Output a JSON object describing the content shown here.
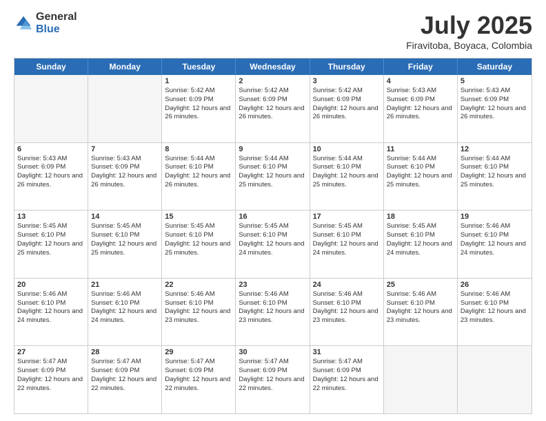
{
  "logo": {
    "general": "General",
    "blue": "Blue"
  },
  "header": {
    "month_year": "July 2025",
    "location": "Firavitoba, Boyaca, Colombia"
  },
  "weekdays": [
    "Sunday",
    "Monday",
    "Tuesday",
    "Wednesday",
    "Thursday",
    "Friday",
    "Saturday"
  ],
  "weeks": [
    [
      {
        "day": "",
        "sunrise": "",
        "sunset": "",
        "daylight": ""
      },
      {
        "day": "",
        "sunrise": "",
        "sunset": "",
        "daylight": ""
      },
      {
        "day": "1",
        "sunrise": "Sunrise: 5:42 AM",
        "sunset": "Sunset: 6:09 PM",
        "daylight": "Daylight: 12 hours and 26 minutes."
      },
      {
        "day": "2",
        "sunrise": "Sunrise: 5:42 AM",
        "sunset": "Sunset: 6:09 PM",
        "daylight": "Daylight: 12 hours and 26 minutes."
      },
      {
        "day": "3",
        "sunrise": "Sunrise: 5:42 AM",
        "sunset": "Sunset: 6:09 PM",
        "daylight": "Daylight: 12 hours and 26 minutes."
      },
      {
        "day": "4",
        "sunrise": "Sunrise: 5:43 AM",
        "sunset": "Sunset: 6:09 PM",
        "daylight": "Daylight: 12 hours and 26 minutes."
      },
      {
        "day": "5",
        "sunrise": "Sunrise: 5:43 AM",
        "sunset": "Sunset: 6:09 PM",
        "daylight": "Daylight: 12 hours and 26 minutes."
      }
    ],
    [
      {
        "day": "6",
        "sunrise": "Sunrise: 5:43 AM",
        "sunset": "Sunset: 6:09 PM",
        "daylight": "Daylight: 12 hours and 26 minutes."
      },
      {
        "day": "7",
        "sunrise": "Sunrise: 5:43 AM",
        "sunset": "Sunset: 6:09 PM",
        "daylight": "Daylight: 12 hours and 26 minutes."
      },
      {
        "day": "8",
        "sunrise": "Sunrise: 5:44 AM",
        "sunset": "Sunset: 6:10 PM",
        "daylight": "Daylight: 12 hours and 26 minutes."
      },
      {
        "day": "9",
        "sunrise": "Sunrise: 5:44 AM",
        "sunset": "Sunset: 6:10 PM",
        "daylight": "Daylight: 12 hours and 25 minutes."
      },
      {
        "day": "10",
        "sunrise": "Sunrise: 5:44 AM",
        "sunset": "Sunset: 6:10 PM",
        "daylight": "Daylight: 12 hours and 25 minutes."
      },
      {
        "day": "11",
        "sunrise": "Sunrise: 5:44 AM",
        "sunset": "Sunset: 6:10 PM",
        "daylight": "Daylight: 12 hours and 25 minutes."
      },
      {
        "day": "12",
        "sunrise": "Sunrise: 5:44 AM",
        "sunset": "Sunset: 6:10 PM",
        "daylight": "Daylight: 12 hours and 25 minutes."
      }
    ],
    [
      {
        "day": "13",
        "sunrise": "Sunrise: 5:45 AM",
        "sunset": "Sunset: 6:10 PM",
        "daylight": "Daylight: 12 hours and 25 minutes."
      },
      {
        "day": "14",
        "sunrise": "Sunrise: 5:45 AM",
        "sunset": "Sunset: 6:10 PM",
        "daylight": "Daylight: 12 hours and 25 minutes."
      },
      {
        "day": "15",
        "sunrise": "Sunrise: 5:45 AM",
        "sunset": "Sunset: 6:10 PM",
        "daylight": "Daylight: 12 hours and 25 minutes."
      },
      {
        "day": "16",
        "sunrise": "Sunrise: 5:45 AM",
        "sunset": "Sunset: 6:10 PM",
        "daylight": "Daylight: 12 hours and 24 minutes."
      },
      {
        "day": "17",
        "sunrise": "Sunrise: 5:45 AM",
        "sunset": "Sunset: 6:10 PM",
        "daylight": "Daylight: 12 hours and 24 minutes."
      },
      {
        "day": "18",
        "sunrise": "Sunrise: 5:45 AM",
        "sunset": "Sunset: 6:10 PM",
        "daylight": "Daylight: 12 hours and 24 minutes."
      },
      {
        "day": "19",
        "sunrise": "Sunrise: 5:46 AM",
        "sunset": "Sunset: 6:10 PM",
        "daylight": "Daylight: 12 hours and 24 minutes."
      }
    ],
    [
      {
        "day": "20",
        "sunrise": "Sunrise: 5:46 AM",
        "sunset": "Sunset: 6:10 PM",
        "daylight": "Daylight: 12 hours and 24 minutes."
      },
      {
        "day": "21",
        "sunrise": "Sunrise: 5:46 AM",
        "sunset": "Sunset: 6:10 PM",
        "daylight": "Daylight: 12 hours and 24 minutes."
      },
      {
        "day": "22",
        "sunrise": "Sunrise: 5:46 AM",
        "sunset": "Sunset: 6:10 PM",
        "daylight": "Daylight: 12 hours and 23 minutes."
      },
      {
        "day": "23",
        "sunrise": "Sunrise: 5:46 AM",
        "sunset": "Sunset: 6:10 PM",
        "daylight": "Daylight: 12 hours and 23 minutes."
      },
      {
        "day": "24",
        "sunrise": "Sunrise: 5:46 AM",
        "sunset": "Sunset: 6:10 PM",
        "daylight": "Daylight: 12 hours and 23 minutes."
      },
      {
        "day": "25",
        "sunrise": "Sunrise: 5:46 AM",
        "sunset": "Sunset: 6:10 PM",
        "daylight": "Daylight: 12 hours and 23 minutes."
      },
      {
        "day": "26",
        "sunrise": "Sunrise: 5:46 AM",
        "sunset": "Sunset: 6:10 PM",
        "daylight": "Daylight: 12 hours and 23 minutes."
      }
    ],
    [
      {
        "day": "27",
        "sunrise": "Sunrise: 5:47 AM",
        "sunset": "Sunset: 6:09 PM",
        "daylight": "Daylight: 12 hours and 22 minutes."
      },
      {
        "day": "28",
        "sunrise": "Sunrise: 5:47 AM",
        "sunset": "Sunset: 6:09 PM",
        "daylight": "Daylight: 12 hours and 22 minutes."
      },
      {
        "day": "29",
        "sunrise": "Sunrise: 5:47 AM",
        "sunset": "Sunset: 6:09 PM",
        "daylight": "Daylight: 12 hours and 22 minutes."
      },
      {
        "day": "30",
        "sunrise": "Sunrise: 5:47 AM",
        "sunset": "Sunset: 6:09 PM",
        "daylight": "Daylight: 12 hours and 22 minutes."
      },
      {
        "day": "31",
        "sunrise": "Sunrise: 5:47 AM",
        "sunset": "Sunset: 6:09 PM",
        "daylight": "Daylight: 12 hours and 22 minutes."
      },
      {
        "day": "",
        "sunrise": "",
        "sunset": "",
        "daylight": ""
      },
      {
        "day": "",
        "sunrise": "",
        "sunset": "",
        "daylight": ""
      }
    ]
  ]
}
